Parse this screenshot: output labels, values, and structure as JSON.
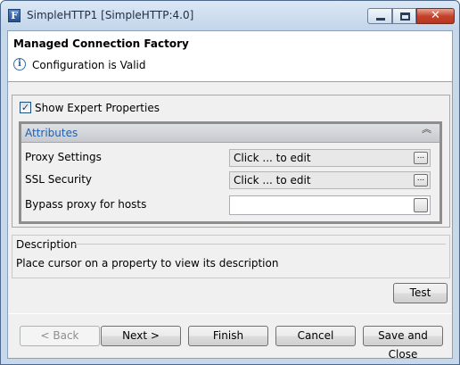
{
  "window": {
    "title": "SimpleHTTP1 [SimpleHTTP:4.0]",
    "app_icon_letter": "F",
    "close_glyph": "✕"
  },
  "header": {
    "title": "Managed Connection Factory",
    "status": "Configuration is Valid",
    "info_glyph": "i"
  },
  "options": {
    "show_expert_label": "Show Expert Properties",
    "show_expert_checked": true,
    "check_glyph": "✓"
  },
  "attributes": {
    "title": "Attributes",
    "collapse_glyph": "︽",
    "properties": [
      {
        "label": "Proxy Settings",
        "value": "Click ... to edit"
      },
      {
        "label": "SSL Security",
        "value": "Click ... to edit"
      },
      {
        "label": "Bypass proxy for hosts",
        "value": ""
      }
    ],
    "ellipsis_glyph": "..."
  },
  "description": {
    "title": "Description",
    "text": "Place cursor on a property to view its description"
  },
  "buttons": {
    "test": "Test",
    "back": "< Back",
    "next": "Next >",
    "finish": "Finish",
    "cancel": "Cancel",
    "save_close": "Save and Close"
  }
}
